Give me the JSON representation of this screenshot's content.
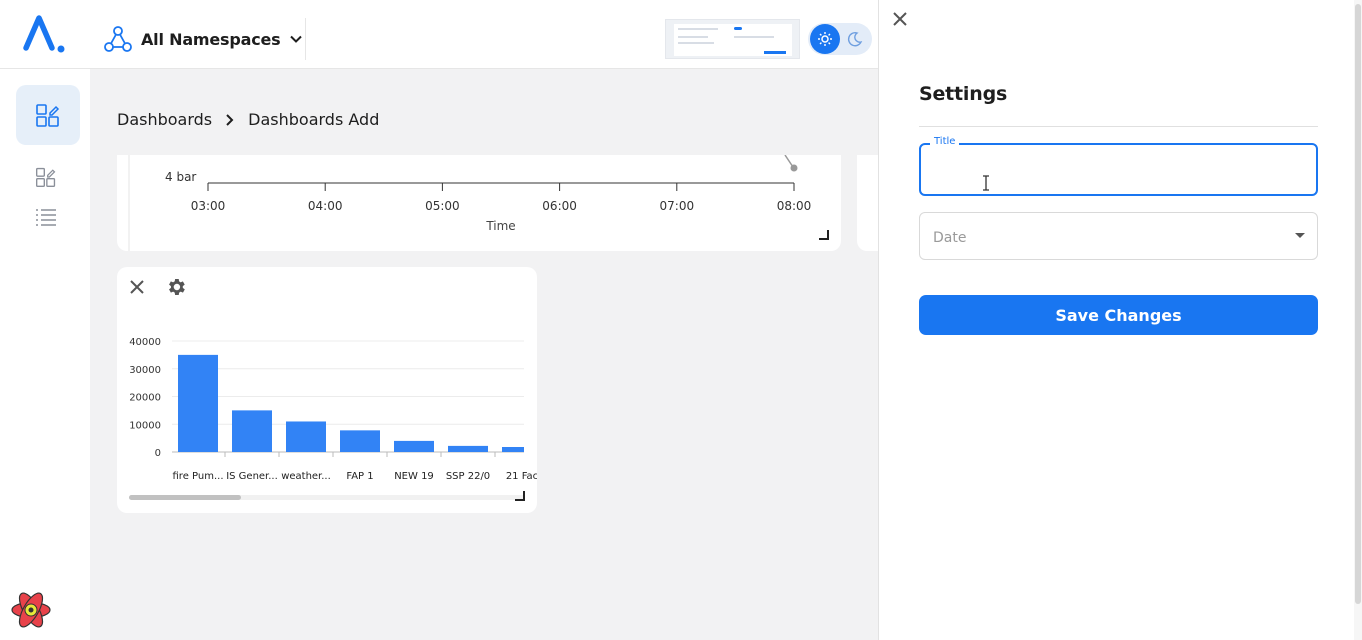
{
  "header": {
    "namespace_label": "All Namespaces"
  },
  "breadcrumb": {
    "root": "Dashboards",
    "current": "Dashboards Add"
  },
  "top_chart": {
    "y_tick": "4 bar",
    "x_ticks": [
      "03:00",
      "04:00",
      "05:00",
      "06:00",
      "07:00",
      "08:00"
    ],
    "xlabel": "Time"
  },
  "chart_data": {
    "type": "bar",
    "categories": [
      "fire Pum...",
      "IS Gener...",
      "weather...",
      "FAP 1",
      "NEW 19",
      "SSP 22/0",
      "21 Fac"
    ],
    "values": [
      35000,
      15000,
      11000,
      7800,
      4000,
      2200,
      1800
    ],
    "ylim": [
      0,
      40000
    ],
    "y_ticks": [
      0,
      10000,
      20000,
      30000,
      40000
    ],
    "grid": true,
    "bar_color": "#3283f5"
  },
  "settings": {
    "title": "Settings",
    "title_field_label": "Title",
    "title_field_value": "",
    "date_placeholder": "Date",
    "save_label": "Save Changes"
  },
  "colors": {
    "accent": "#1976f1",
    "bar": "#3283f5"
  },
  "icons": {
    "logo": "app-logo-icon",
    "namespace": "network-icon",
    "theme_light": "sun-icon",
    "theme_dark": "moon-icon",
    "close": "close-icon",
    "settings": "gear-icon",
    "dashboard": "dashboard-edit-icon",
    "list": "list-icon",
    "react": "react-devtools-icon"
  }
}
